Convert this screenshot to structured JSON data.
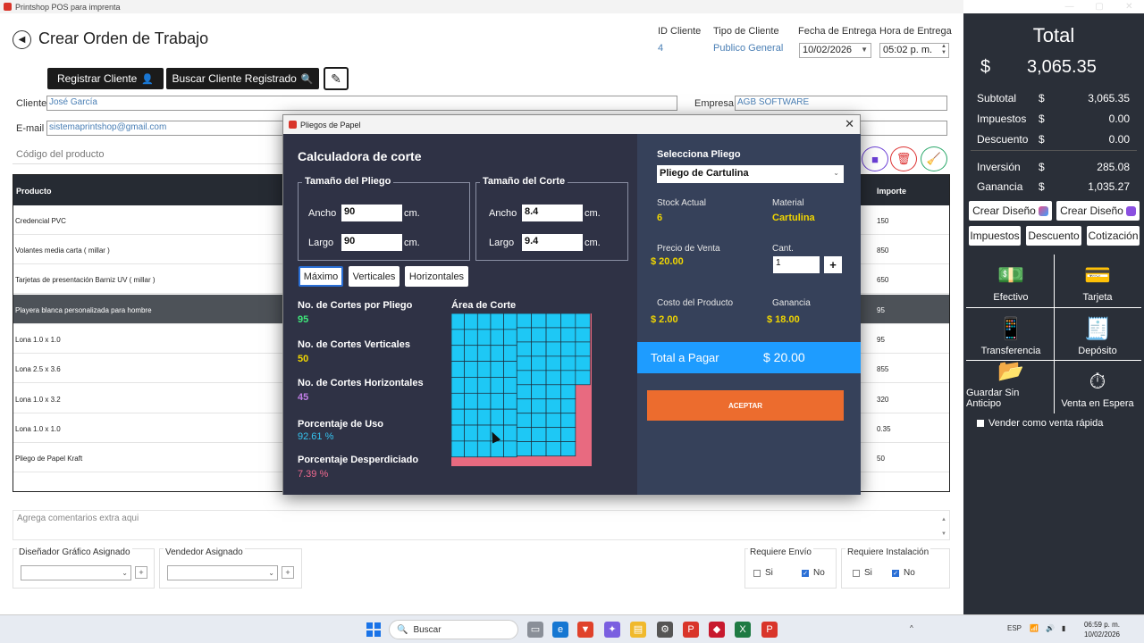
{
  "window": {
    "title": "Printshop POS para imprenta",
    "controls": [
      "—",
      "▢",
      "✕"
    ]
  },
  "header": {
    "title": "Crear Orden de Trabajo",
    "id_cliente_label": "ID Cliente",
    "id_cliente_value": "4",
    "tipo_cliente_label": "Tipo de Cliente",
    "tipo_cliente_value": "Publico General",
    "fecha_label": "Fecha de Entrega",
    "fecha_value": "10/02/2026",
    "hora_label": "Hora  de Entrega",
    "hora_value": "05:02 p. m."
  },
  "toolbar": {
    "registrar_label": "Registrar Cliente",
    "buscar_label": "Buscar Cliente Registrado"
  },
  "form": {
    "cliente_label": "Cliente",
    "cliente_value": "José García",
    "empresa_label": "Empresa",
    "empresa_value": "AGB SOFTWARE",
    "email_label": "E-mail",
    "email_value": "sistemaprintshop@gmail.com",
    "codigo_placeholder": "Código del producto"
  },
  "table": {
    "col_producto": "Producto",
    "col_importe": "Importe",
    "rows": [
      {
        "producto": "Credencial PVC",
        "importe": "150"
      },
      {
        "producto": "Volantes media carta ( millar )",
        "importe": "850"
      },
      {
        "producto": "Tarjetas de presentación Barniz UV ( millar )",
        "importe": "650"
      },
      {
        "producto": "Playera blanca personalizada para hombre",
        "importe": "95"
      },
      {
        "producto": "Lona  1.0 x 1.0",
        "importe": "95"
      },
      {
        "producto": "Lona  2.5 x 3.6",
        "importe": "855"
      },
      {
        "producto": "Lona 1.0 x 3.2",
        "importe": "320"
      },
      {
        "producto": "Lona 1.0 x 1.0",
        "importe": "0.35"
      },
      {
        "producto": "Pliego de Papel Kraft",
        "importe": "50"
      }
    ]
  },
  "comments_placeholder": "Agrega comentarios extra aqui",
  "bottom": {
    "disenador_label": "Diseñador Gráfico Asignado",
    "vendedor_label": "Vendedor Asignado",
    "envio_label": "Requiere Envío",
    "instalacion_label": "Requiere Instalación",
    "si": "Si",
    "no": "No"
  },
  "summary": {
    "title": "Total",
    "currency": "$",
    "total": "3,065.35",
    "subtotal_label": "Subtotal",
    "subtotal": "3,065.35",
    "impuestos_label": "Impuestos",
    "impuestos": "0.00",
    "descuento_label": "Descuento",
    "descuento": "0.00",
    "inversion_label": "Inversión",
    "inversion": "285.08",
    "ganancia_label": "Ganancia",
    "ganancia": "1,035.27",
    "btn_crear_diseno_1": "Crear Diseño",
    "btn_crear_diseno_2": "Crear Diseño",
    "btn_impuestos": "Impuestos",
    "btn_descuento": "Descuento",
    "btn_cotizacion": "Cotización",
    "pay_efectivo": "Efectivo",
    "pay_tarjeta": "Tarjeta",
    "pay_transferencia": "Transferencia",
    "pay_deposito": "Depósito",
    "pay_guardar": "Guardar Sin Anticipo",
    "pay_espera": "Venta en Espera",
    "venta_rapida": "Vender como venta rápida"
  },
  "modal": {
    "title": "Pliegos de Papel",
    "calc_title": "Calculadora de corte",
    "pliego_legend": "Tamaño del Pliego",
    "corte_legend": "Tamaño del Corte",
    "ancho_label": "Ancho",
    "largo_label": "Largo",
    "unit": "cm.",
    "pliego_ancho": "90",
    "pliego_largo": "90",
    "corte_ancho": "8.4",
    "corte_largo": "9.4",
    "tab_maximo": "Máximo",
    "tab_verticales": "Verticales",
    "tab_horizontales": "Horizontales",
    "cortes_pliego_label": "No. de Cortes por Pliego",
    "cortes_pliego": "95",
    "cortes_vert_label": "No. de Cortes Verticales",
    "cortes_vert": "50",
    "cortes_hor_label": "No. de Cortes Horizontales",
    "cortes_hor": "45",
    "uso_label": "Porcentaje de Uso",
    "uso": "92.61 %",
    "desp_label": "Porcentaje Desperdiciado",
    "desp": "7.39 %",
    "area_label": "Área de Corte",
    "selecciona_label": "Selecciona Pliego",
    "pliego_selected": "Pliego de Cartulina",
    "stock_label": "Stock Actual",
    "stock": "6",
    "material_label": "Material",
    "material": "Cartulina",
    "precio_label": "Precio de Venta",
    "precio": "$ 20.00",
    "cant_label": "Cant.",
    "cant": "1",
    "costo_label": "Costo del Producto",
    "costo": "$  2.00",
    "ganancia_label": "Ganancia",
    "ganancia": "$  18.00",
    "total_label": "Total a Pagar",
    "total": "$  20.00",
    "aceptar": "ACEPTAR"
  },
  "taskbar": {
    "search_placeholder": "Buscar",
    "lang": "ESP",
    "time": "06:59 p. m.",
    "date": "10/02/2026"
  },
  "colors": {
    "accent_blue": "#1e9cff",
    "accept_orange": "#ec6c2e",
    "value_yellow": "#f1d600",
    "value_green": "#3ee87a",
    "value_purple": "#c07ee6",
    "value_cyan": "#35c4f0",
    "value_pink": "#f06a90",
    "cut_cell": "#1ec8f5"
  }
}
